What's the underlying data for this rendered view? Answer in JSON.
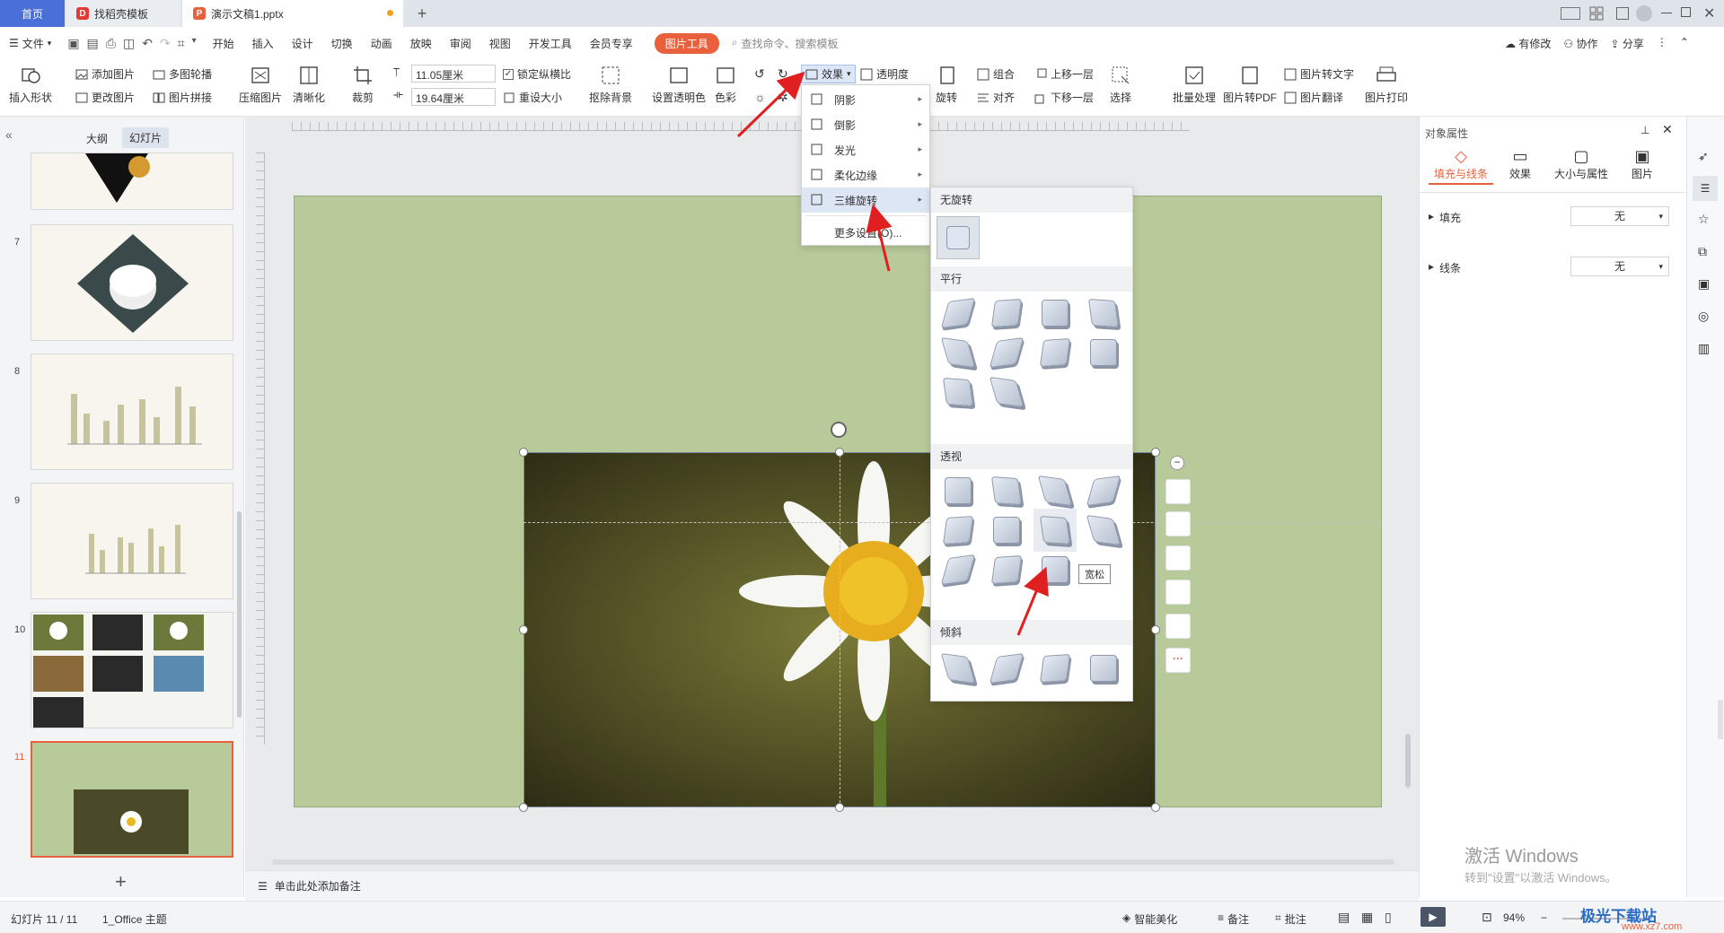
{
  "tabs": {
    "home": "首页",
    "t1": "找稻壳模板",
    "t2": "演示文稿1.pptx"
  },
  "menubar": {
    "file": "文件",
    "items": [
      "开始",
      "插入",
      "设计",
      "切换",
      "动画",
      "放映",
      "审阅",
      "视图",
      "开发工具",
      "会员专享"
    ],
    "pic_tools": "图片工具",
    "search_placeholder": "查找命令、搜索模板",
    "revise": "有修改",
    "collab": "协作",
    "share": "分享"
  },
  "ribbon": {
    "insert_shape": "插入形状",
    "add_pic": "添加图片",
    "change_pic": "更改图片",
    "multi_outline": "多图轮播",
    "pic_collage": "图片拼接",
    "compress": "压缩图片",
    "sharpen": "清晰化",
    "crop": "裁剪",
    "width": "11.05厘米",
    "height": "19.64厘米",
    "lock_ratio": "锁定纵横比",
    "reset_size": "重设大小",
    "remove_bg": "抠除背景",
    "set_transparent": "设置透明色",
    "color": "色彩",
    "effects": "效果",
    "transparency": "透明度",
    "rotate": "旋转",
    "group": "组合",
    "align": "对齐",
    "bring_forward": "上移一层",
    "send_backward": "下移一层",
    "select": "选择",
    "batch": "批量处理",
    "to_pdf": "图片转PDF",
    "to_text": "图片转文字",
    "translate": "图片翻译",
    "print": "图片打印"
  },
  "leftpanel": {
    "tab_outline": "大纲",
    "tab_slides": "幻灯片",
    "slide_nums": [
      "7",
      "8",
      "9",
      "10",
      "11"
    ]
  },
  "effects_menu": {
    "items": [
      "阴影",
      "倒影",
      "发光",
      "柔化边缘",
      "三维旋转"
    ],
    "more": "更多设置(O)..."
  },
  "rotation_submenu": {
    "no_rotation": "无旋转",
    "parallel": "平行",
    "perspective": "透视",
    "oblique": "倾斜",
    "tooltip": "宽松"
  },
  "rightpanel": {
    "title": "对象属性",
    "tabs": [
      "填充与线条",
      "效果",
      "大小与属性",
      "图片"
    ],
    "fill_label": "填充",
    "fill_value": "无",
    "line_label": "线条",
    "line_value": "无"
  },
  "notes": "单击此处添加备注",
  "status": {
    "slide": "幻灯片 11 / 11",
    "theme": "1_Office 主题",
    "beautify": "智能美化",
    "notes": "备注",
    "comments": "批注",
    "zoom": "94%"
  },
  "watermark": {
    "line1": "激活 Windows",
    "line2": "转到\"设置\"以激活 Windows。",
    "site": "极光下载站",
    "url": "www.xz7.com"
  },
  "colors": {
    "accent": "#4a6fd6",
    "pic_tools": "#e8613c",
    "slide_bg": "#b8ca9a",
    "arrow": "#e02020"
  }
}
